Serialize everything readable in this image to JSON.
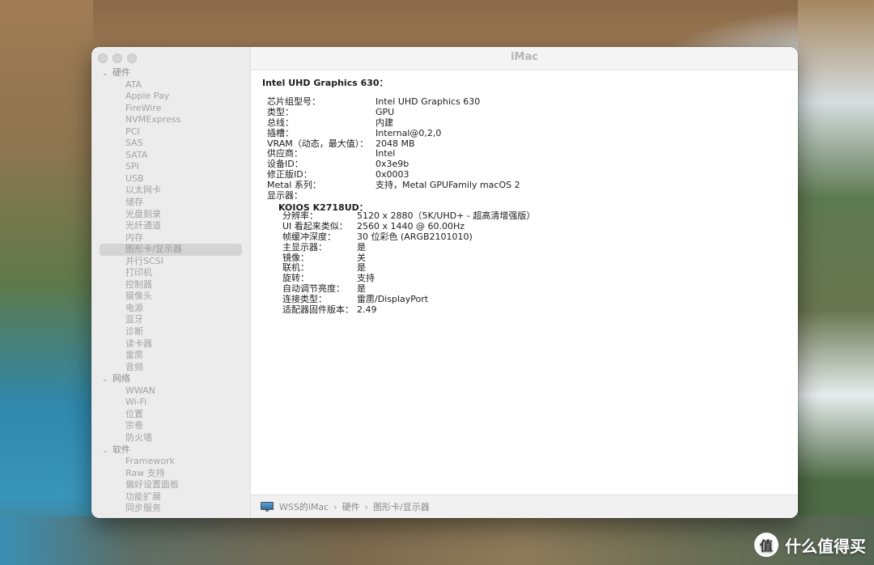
{
  "window": {
    "title": "iMac"
  },
  "sidebar": {
    "items": [
      {
        "type": "cat",
        "label": "硬件"
      },
      {
        "type": "child",
        "label": "ATA"
      },
      {
        "type": "child",
        "label": "Apple Pay"
      },
      {
        "type": "child",
        "label": "FireWire"
      },
      {
        "type": "child",
        "label": "NVMExpress"
      },
      {
        "type": "child",
        "label": "PCI"
      },
      {
        "type": "child",
        "label": "SAS"
      },
      {
        "type": "child",
        "label": "SATA"
      },
      {
        "type": "child",
        "label": "SPI"
      },
      {
        "type": "child",
        "label": "USB"
      },
      {
        "type": "child",
        "label": "以太网卡"
      },
      {
        "type": "child",
        "label": "储存"
      },
      {
        "type": "child",
        "label": "光盘刻录"
      },
      {
        "type": "child",
        "label": "光纤通道"
      },
      {
        "type": "child",
        "label": "内存"
      },
      {
        "type": "child",
        "label": "图形卡/显示器",
        "selected": true
      },
      {
        "type": "child",
        "label": "并行SCSI"
      },
      {
        "type": "child",
        "label": "打印机"
      },
      {
        "type": "child",
        "label": "控制器"
      },
      {
        "type": "child",
        "label": "摄像头"
      },
      {
        "type": "child",
        "label": "电源"
      },
      {
        "type": "child",
        "label": "蓝牙"
      },
      {
        "type": "child",
        "label": "诊断"
      },
      {
        "type": "child",
        "label": "读卡器"
      },
      {
        "type": "child",
        "label": "雷雳"
      },
      {
        "type": "child",
        "label": "音频"
      },
      {
        "type": "cat",
        "label": "网络"
      },
      {
        "type": "child",
        "label": "WWAN"
      },
      {
        "type": "child",
        "label": "Wi-Fi"
      },
      {
        "type": "child",
        "label": "位置"
      },
      {
        "type": "child",
        "label": "宗卷"
      },
      {
        "type": "child",
        "label": "防火墙"
      },
      {
        "type": "cat",
        "label": "软件"
      },
      {
        "type": "child",
        "label": "Framework"
      },
      {
        "type": "child",
        "label": "Raw 支持"
      },
      {
        "type": "child",
        "label": "偏好设置面板"
      },
      {
        "type": "child",
        "label": "功能扩展"
      },
      {
        "type": "child",
        "label": "同步服务"
      }
    ]
  },
  "main": {
    "heading": "Intel UHD Graphics 630：",
    "properties": [
      {
        "k": "芯片组型号：",
        "v": "Intel UHD Graphics 630"
      },
      {
        "k": "类型：",
        "v": "GPU"
      },
      {
        "k": "总线：",
        "v": "内建"
      },
      {
        "k": "插槽：",
        "v": "Internal@0,2,0"
      },
      {
        "k": "VRAM（动态，最大值）：",
        "v": "2048 MB"
      },
      {
        "k": "供应商：",
        "v": "Intel"
      },
      {
        "k": "设备ID：",
        "v": "0x3e9b"
      },
      {
        "k": "修正版ID：",
        "v": "0x0003"
      },
      {
        "k": "Metal 系列：",
        "v": "支持，Metal GPUFamily macOS 2"
      },
      {
        "k": "显示器：",
        "v": ""
      }
    ],
    "display_name": "KOIOS K2718UD：",
    "display_properties": [
      {
        "k": "分辨率：",
        "v": "5120 x 2880（5K/UHD+ - 超高清增强版）"
      },
      {
        "k": "UI 看起来类似：",
        "v": "2560 x 1440 @ 60.00Hz"
      },
      {
        "k": "帧缓冲深度：",
        "v": "30 位彩色 (ARGB2101010)"
      },
      {
        "k": "主显示器：",
        "v": "是"
      },
      {
        "k": "镜像：",
        "v": "关"
      },
      {
        "k": "联机：",
        "v": "是"
      },
      {
        "k": "旋转：",
        "v": "支持"
      },
      {
        "k": "自动调节亮度：",
        "v": "是"
      },
      {
        "k": "连接类型：",
        "v": "雷雳/DisplayPort"
      },
      {
        "k": "适配器固件版本：",
        "v": "2.49"
      }
    ]
  },
  "pathbar": {
    "items": [
      "WSS的iMac",
      "硬件",
      "图形卡/显示器"
    ],
    "separator": "›"
  },
  "watermark": {
    "logo": "值",
    "text": "什么值得买"
  }
}
